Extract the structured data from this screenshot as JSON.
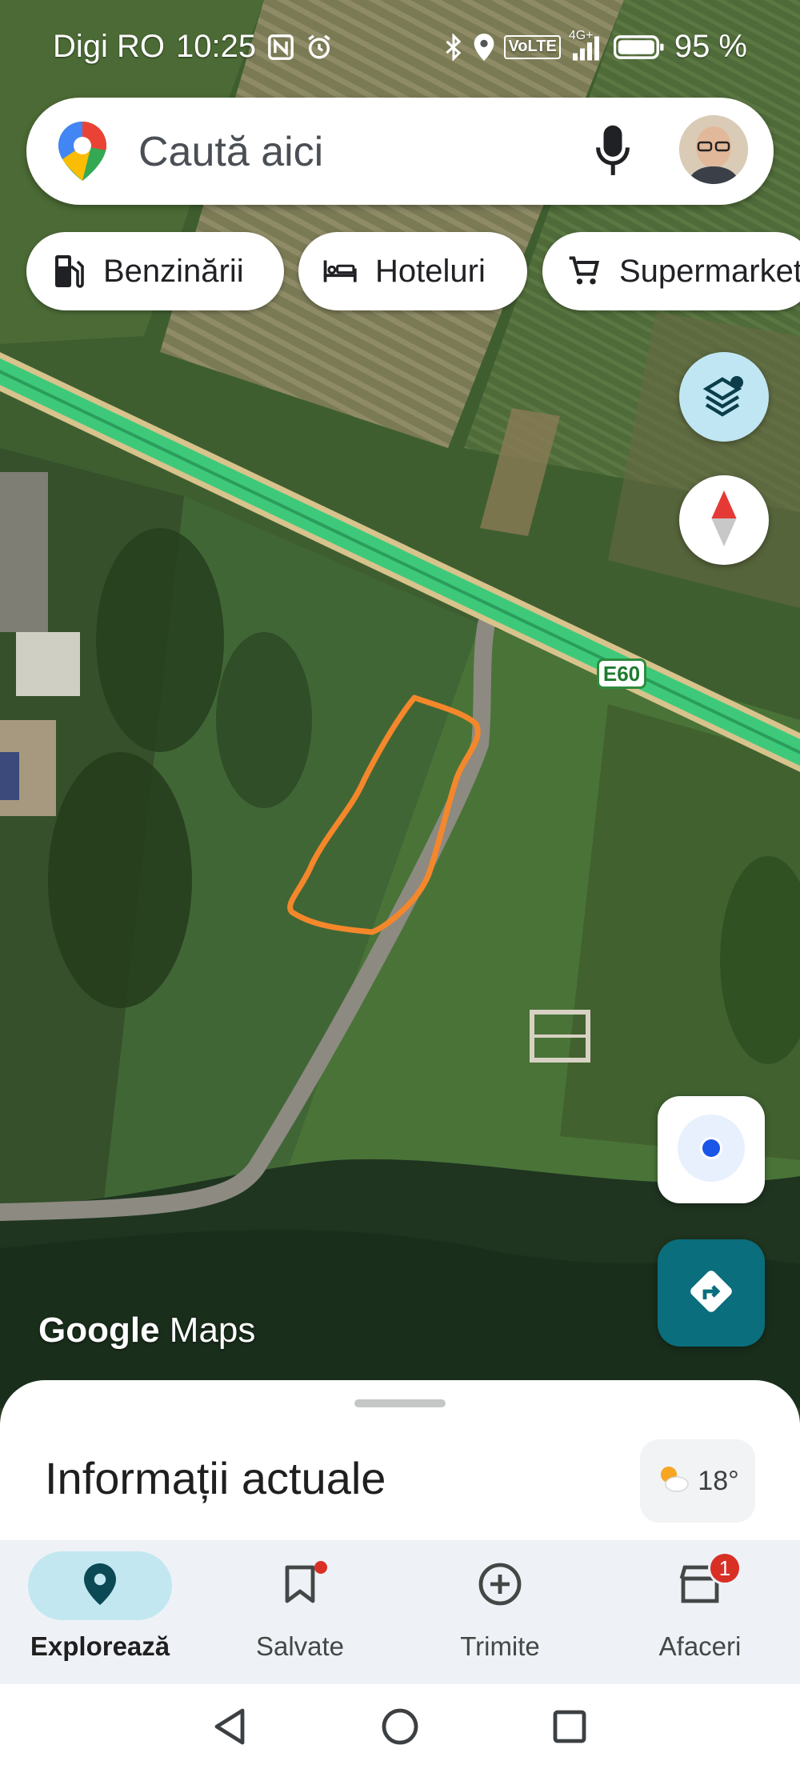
{
  "status_bar": {
    "carrier": "Digi RO",
    "time": "10:25",
    "network": "4G+",
    "volte": "VoLTE",
    "battery": "95 %"
  },
  "search": {
    "placeholder": "Caută aici"
  },
  "chips": [
    {
      "label": "Benzinării",
      "icon": "gas-station-icon"
    },
    {
      "label": "Hoteluri",
      "icon": "bed-icon"
    },
    {
      "label": "Supermarket",
      "icon": "cart-icon"
    }
  ],
  "map": {
    "road_label": "E60",
    "logo_google": "Google",
    "logo_maps": "Maps",
    "highlight_color": "#f5872b",
    "highway_color": "#3ec97a"
  },
  "sheet": {
    "title": "Informații actuale",
    "temperature": "18°"
  },
  "nav": {
    "items": [
      {
        "label": "Explorează",
        "icon": "explore-pin-icon",
        "active": true
      },
      {
        "label": "Salvate",
        "icon": "bookmark-icon"
      },
      {
        "label": "Trimite",
        "icon": "add-circle-icon"
      },
      {
        "label": "Afaceri",
        "icon": "store-icon",
        "badge": "1"
      }
    ]
  },
  "colors": {
    "accent": "#00606a",
    "active_pill": "#c2e7f0",
    "badge": "#d93025"
  }
}
